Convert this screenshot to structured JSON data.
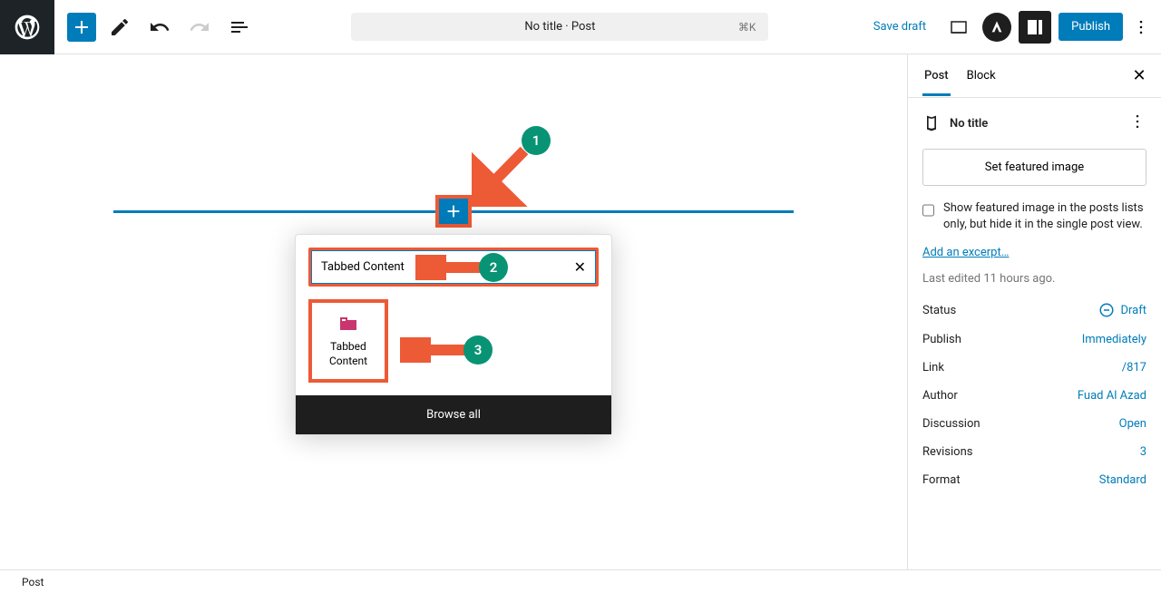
{
  "toolbar": {
    "title": "No title · Post",
    "shortcut": "⌘K",
    "save_draft": "Save draft",
    "publish": "Publish"
  },
  "inserter": {
    "search_value": "Tabbed Content",
    "result_label": "Tabbed Content",
    "browse_all": "Browse all"
  },
  "annotations": {
    "step1": "1",
    "step2": "2",
    "step3": "3"
  },
  "sidebar": {
    "tabs": {
      "post": "Post",
      "block": "Block"
    },
    "post_title": "No title",
    "featured_btn": "Set featured image",
    "featured_checkbox": "Show featured image in the posts lists only, but hide it in the single post view.",
    "excerpt_link": "Add an excerpt…",
    "last_edited": "Last edited 11 hours ago.",
    "fields": {
      "status": {
        "label": "Status",
        "value": "Draft"
      },
      "publish": {
        "label": "Publish",
        "value": "Immediately"
      },
      "link": {
        "label": "Link",
        "value": "/817"
      },
      "author": {
        "label": "Author",
        "value": "Fuad Al Azad"
      },
      "discussion": {
        "label": "Discussion",
        "value": "Open"
      },
      "revisions": {
        "label": "Revisions",
        "value": "3"
      },
      "format": {
        "label": "Format",
        "value": "Standard"
      }
    }
  },
  "footer": {
    "breadcrumb": "Post"
  }
}
